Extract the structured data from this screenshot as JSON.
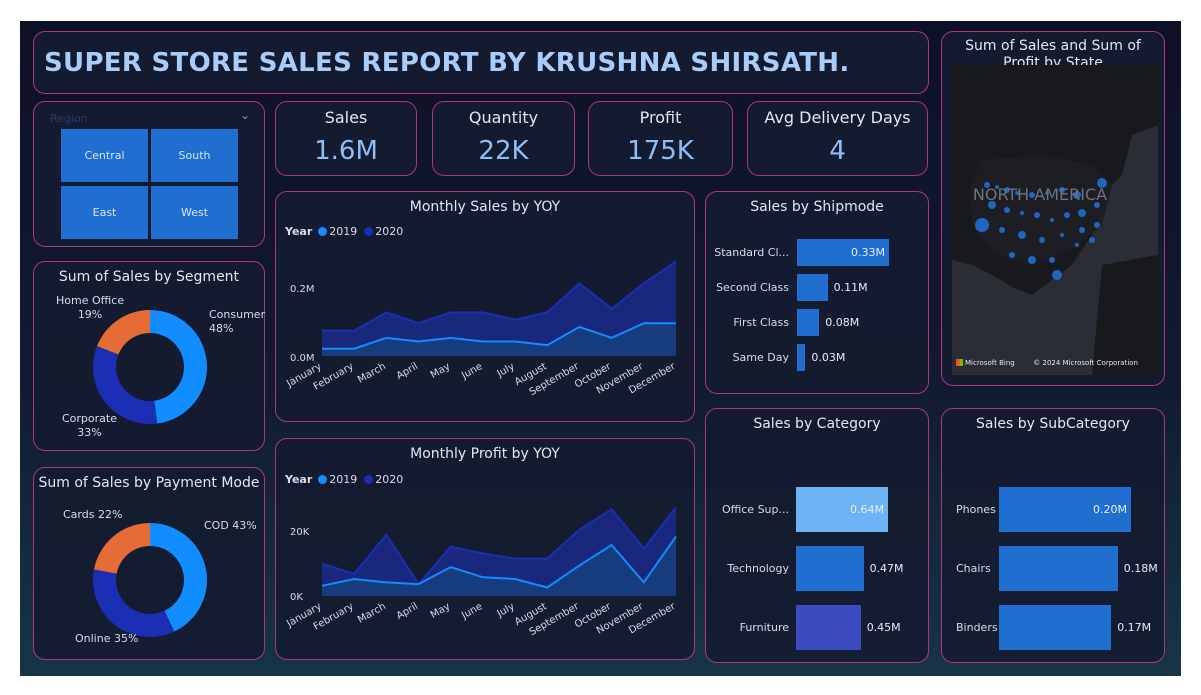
{
  "title": "SUPER STORE SALES REPORT BY KRUSHNA SHIRSATH.",
  "slicer": {
    "header": "Region",
    "regions": [
      "Central",
      "South",
      "East",
      "West"
    ]
  },
  "kpis": [
    {
      "label": "Sales",
      "value": "1.6M"
    },
    {
      "label": "Quantity",
      "value": "22K"
    },
    {
      "label": "Profit",
      "value": "175K"
    },
    {
      "label": "Avg Delivery Days",
      "value": "4"
    }
  ],
  "segment": {
    "title": "Sum of Sales by Segment",
    "slices": [
      {
        "name": "Consumer",
        "pct": "48%",
        "value": 48,
        "color": "#118dff"
      },
      {
        "name": "Corporate",
        "pct": "33%",
        "value": 33,
        "color": "#1b2fb5"
      },
      {
        "name": "Home Office",
        "pct": "19%",
        "value": 19,
        "color": "#e66c37"
      }
    ]
  },
  "payment": {
    "title": "Sum of Sales by Payment Mode",
    "slices": [
      {
        "label": "COD 43%",
        "value": 43,
        "color": "#118dff"
      },
      {
        "label": "Online 35%",
        "value": 35,
        "color": "#1b2fb5"
      },
      {
        "label": "Cards 22%",
        "value": 22,
        "color": "#e66c37"
      }
    ]
  },
  "monthly_sales": {
    "title": "Monthly Sales by YOY",
    "legend_title": "Year",
    "series_names": [
      "2019",
      "2020"
    ],
    "y_ticks": [
      "0.2M",
      "0.0M"
    ]
  },
  "monthly_profit": {
    "title": "Monthly Profit by YOY",
    "legend_title": "Year",
    "series_names": [
      "2019",
      "2020"
    ],
    "y_ticks": [
      "20K",
      "0K"
    ]
  },
  "shipmode": {
    "title": "Sales by Shipmode",
    "items": [
      {
        "label": "Standard Cl...",
        "value": 0.33,
        "text": "0.33M"
      },
      {
        "label": "Second Class",
        "value": 0.11,
        "text": "0.11M"
      },
      {
        "label": "First Class",
        "value": 0.08,
        "text": "0.08M"
      },
      {
        "label": "Same Day",
        "value": 0.03,
        "text": "0.03M"
      }
    ]
  },
  "category": {
    "title": "Sales by Category",
    "items": [
      {
        "label": "Office Sup...",
        "value": 0.64,
        "text": "0.64M",
        "color": "#6cb4f5"
      },
      {
        "label": "Technology",
        "value": 0.47,
        "text": "0.47M",
        "color": "#1f6ed0"
      },
      {
        "label": "Furniture",
        "value": 0.45,
        "text": "0.45M",
        "color": "#3c4cc0"
      }
    ]
  },
  "subcategory": {
    "title": "Sales by SubCategory",
    "items": [
      {
        "label": "Phones",
        "value": 0.2,
        "text": "0.20M"
      },
      {
        "label": "Chairs",
        "value": 0.18,
        "text": "0.18M"
      },
      {
        "label": "Binders",
        "value": 0.17,
        "text": "0.17M"
      }
    ]
  },
  "map": {
    "title": "Sum of Sales and Sum of Profit by State",
    "label": "NORTH AMERICA",
    "credit_left": "Microsoft Bing",
    "credit_right": "© 2024 Microsoft Corporation"
  },
  "chart_data": [
    {
      "type": "area",
      "title": "Monthly Sales by YOY",
      "x": [
        "January",
        "February",
        "March",
        "April",
        "May",
        "June",
        "July",
        "August",
        "September",
        "October",
        "November",
        "December"
      ],
      "series": [
        {
          "name": "2019",
          "values": [
            0.02,
            0.02,
            0.05,
            0.04,
            0.05,
            0.04,
            0.04,
            0.03,
            0.08,
            0.05,
            0.09,
            0.09
          ]
        },
        {
          "name": "2020",
          "values": [
            0.07,
            0.07,
            0.12,
            0.09,
            0.12,
            0.12,
            0.1,
            0.12,
            0.2,
            0.13,
            0.2,
            0.26
          ]
        }
      ],
      "ylim": [
        0,
        0.3
      ]
    },
    {
      "type": "area",
      "title": "Monthly Profit by YOY",
      "x": [
        "January",
        "February",
        "March",
        "April",
        "May",
        "June",
        "July",
        "August",
        "September",
        "October",
        "November",
        "December"
      ],
      "series": [
        {
          "name": "2019",
          "values": [
            3000,
            5000,
            4000,
            3500,
            8500,
            5500,
            5000,
            2500,
            9000,
            15000,
            4000,
            17500
          ]
        },
        {
          "name": "2020",
          "values": [
            9500,
            6500,
            18000,
            3500,
            14500,
            12500,
            11000,
            11000,
            19500,
            25500,
            14000,
            26000
          ]
        }
      ],
      "ylim": [
        0,
        30000
      ]
    }
  ]
}
